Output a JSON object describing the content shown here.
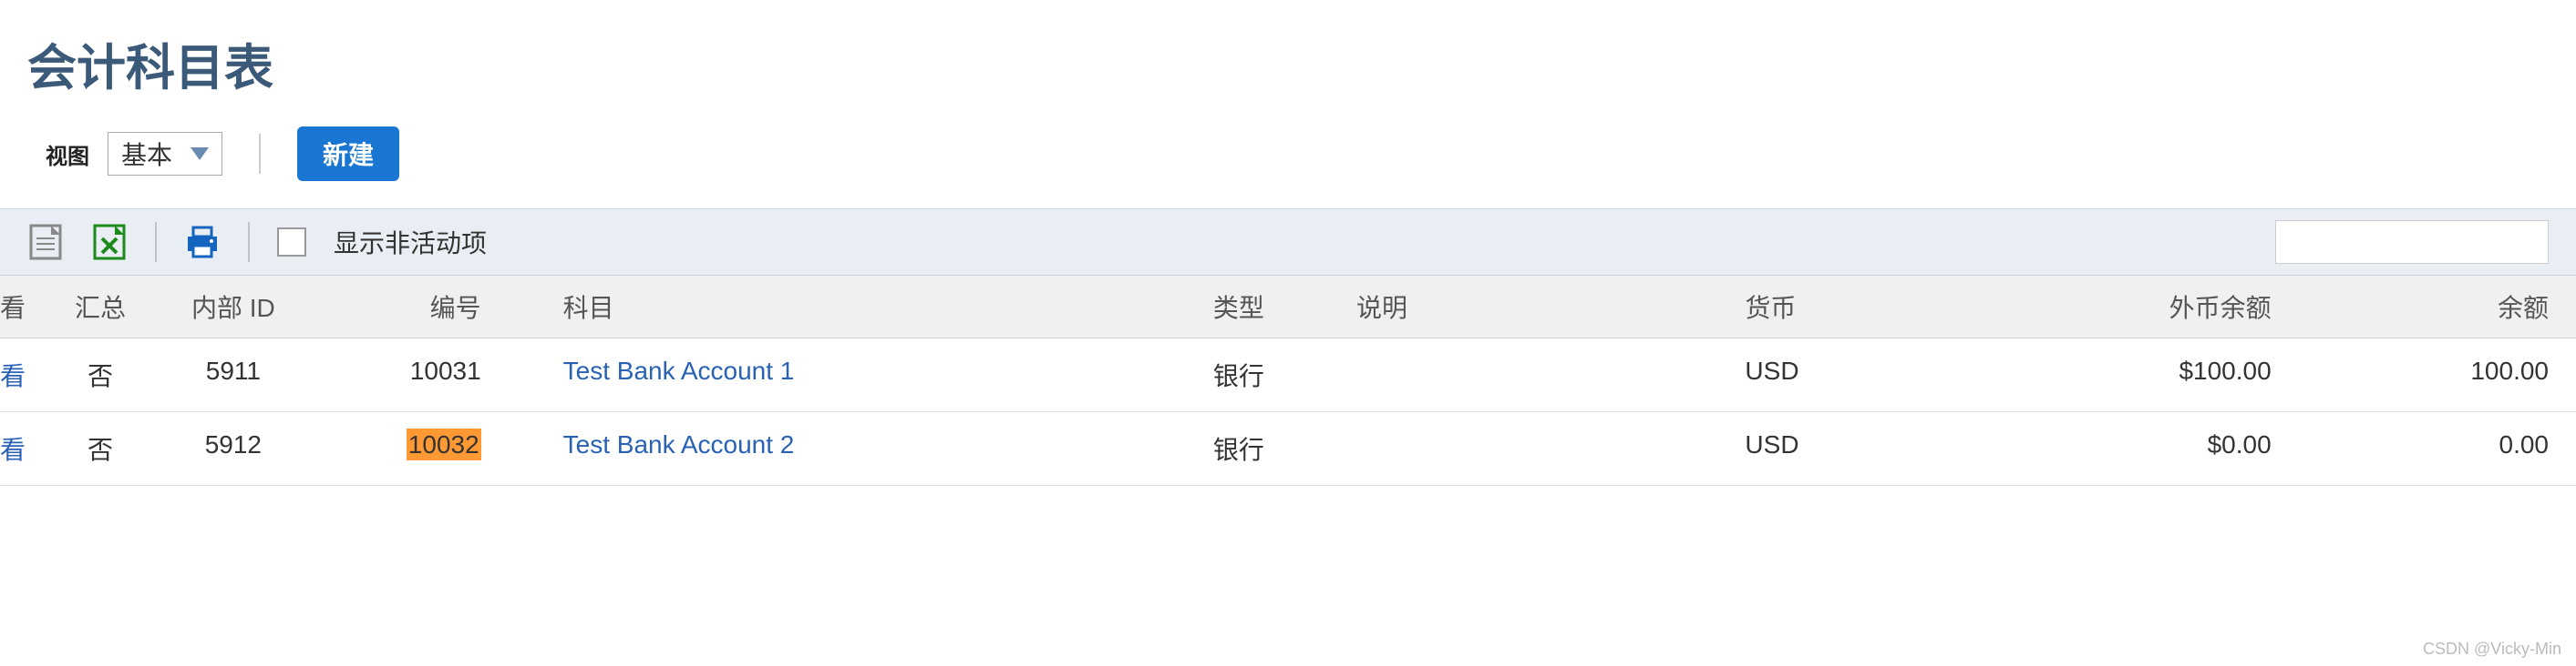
{
  "page": {
    "title": "会计科目表"
  },
  "toolbar": {
    "view_label": "视图",
    "view_selected": "基本",
    "new_button": "新建"
  },
  "action_bar": {
    "show_inactive_label": "显示非活动项"
  },
  "table": {
    "headers": {
      "view": "看",
      "summary": "汇总",
      "internal_id": "内部 ID",
      "number": "编号",
      "subject": "科目",
      "type": "类型",
      "description": "说明",
      "currency": "货币",
      "foreign_balance": "外币余额",
      "balance": "余额"
    },
    "rows": [
      {
        "view": "看",
        "summary": "否",
        "internal_id": "5911",
        "number": "10031",
        "number_highlighted": false,
        "subject": "Test Bank Account 1",
        "type": "银行",
        "description": "",
        "currency": "USD",
        "foreign_balance": "$100.00",
        "balance": "100.00"
      },
      {
        "view": "看",
        "summary": "否",
        "internal_id": "5912",
        "number": "10032",
        "number_highlighted": true,
        "subject": "Test Bank Account 2",
        "type": "银行",
        "description": "",
        "currency": "USD",
        "foreign_balance": "$0.00",
        "balance": "0.00"
      }
    ]
  },
  "watermark": "CSDN @Vicky-Min"
}
